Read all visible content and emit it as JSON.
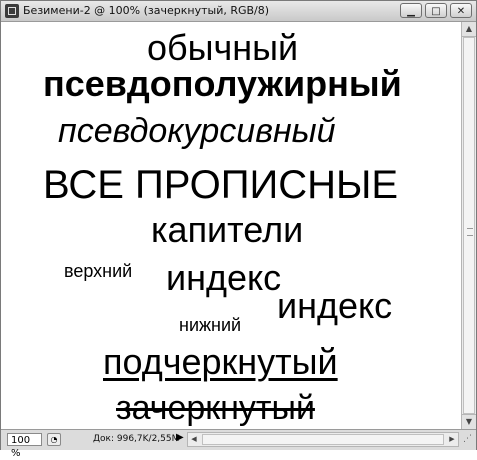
{
  "window": {
    "title": "Безимени-2 @ 100% (зачеркнутый, RGB/8)",
    "buttons": {
      "minimize": "▁",
      "maximize": "□",
      "close": "✕"
    }
  },
  "canvas": {
    "normal": "обычный",
    "faux_bold": "псевдополужирный",
    "faux_italic": "псевдокурсивный",
    "all_caps": "ВСЕ ПРОПИСНЫЕ",
    "small_caps": "капители",
    "superscript_label": "верхний",
    "superscript_word": "индекс",
    "subscript_word": "индекс",
    "subscript_label": "нижний",
    "underline": "подчеркнутый",
    "strikethrough": "зачеркнутый"
  },
  "status": {
    "zoom": "100 %",
    "doc_info": "Док: 996,7K/2,55M",
    "doc_arrow": "▶"
  },
  "icons": {
    "app": "photoshop-document-icon",
    "nav": "navigator-icon",
    "resize": "resize-grip-icon"
  }
}
